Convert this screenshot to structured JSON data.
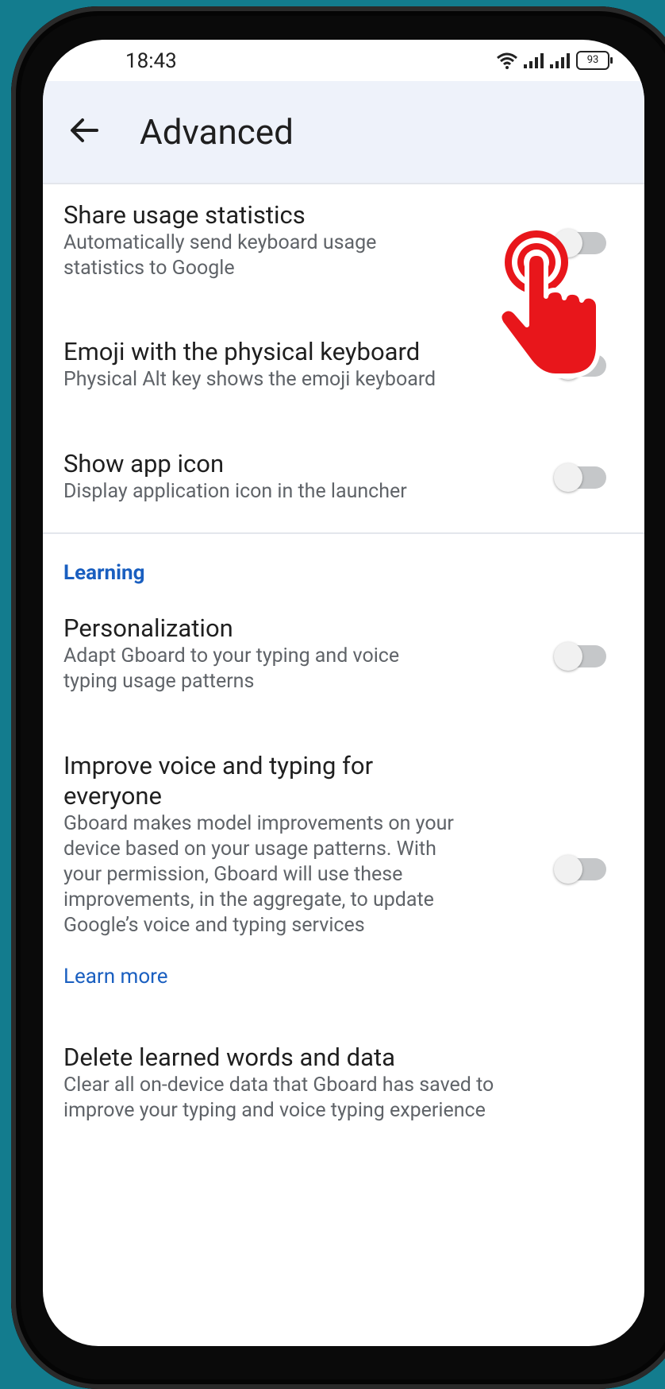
{
  "status_bar": {
    "time": "18:43",
    "battery": "93",
    "icons": [
      "wifi-icon",
      "signal-icon",
      "signal-icon",
      "battery-icon"
    ]
  },
  "app_bar": {
    "back_icon": "arrow-left-icon",
    "title": "Advanced"
  },
  "settings": [
    {
      "title": "Share usage statistics",
      "subtitle": "Automatically send keyboard usage statistics to Google",
      "enabled": false
    },
    {
      "title": "Emoji with the physical keyboard",
      "subtitle": "Physical Alt key shows the emoji keyboard",
      "enabled": false
    },
    {
      "title": "Show app icon",
      "subtitle": "Display application icon in the launcher",
      "enabled": false
    }
  ],
  "learning": {
    "header": "Learning",
    "personalization": {
      "title": "Personalization",
      "subtitle": "Adapt Gboard to your typing and voice typing usage patterns",
      "enabled": false
    },
    "improve": {
      "title": "Improve voice and typing for everyone",
      "subtitle": "Gboard makes model improvements on your device based on your usage patterns. With your permission, Gboard will use these improvements, in the aggregate, to update Google’s voice and typing services",
      "enabled": false,
      "link": "Learn more"
    },
    "delete": {
      "title": "Delete learned words and data",
      "subtitle": "Clear all on-device data that Gboard has saved to improve your typing and voice typing experience"
    }
  },
  "colors": {
    "background": "#137c8e",
    "accent": "#1a5fc0",
    "pointer": "#e8161b"
  }
}
